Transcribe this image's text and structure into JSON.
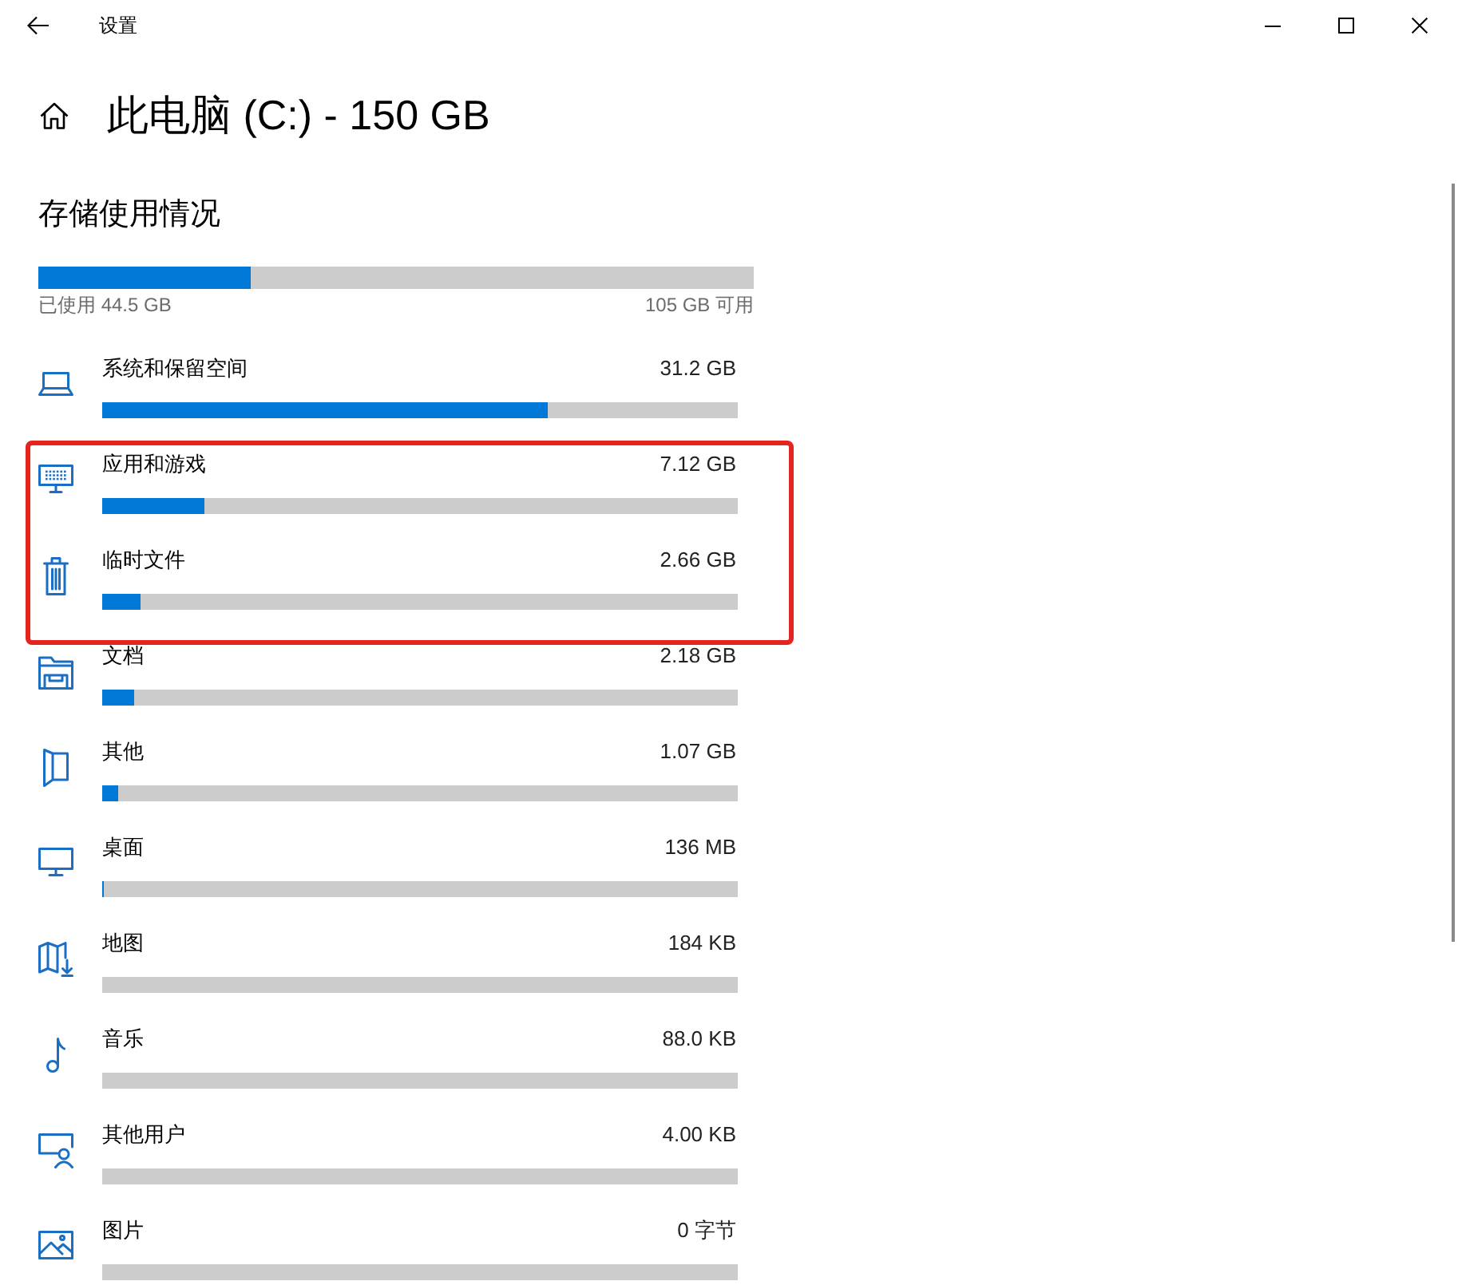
{
  "window": {
    "title": "设置"
  },
  "page": {
    "title": "此电脑 (C:) - 150 GB"
  },
  "storage": {
    "heading": "存储使用情况",
    "level": 0.297,
    "used": "已使用 44.5 GB",
    "free": "105 GB 可用"
  },
  "categories": [
    {
      "kind": "system",
      "label": "系统和保留空间",
      "size": "31.2 GB",
      "level": 0.701,
      "highlighted": false
    },
    {
      "kind": "apps",
      "label": "应用和游戏",
      "size": "7.12 GB",
      "level": 0.16,
      "highlighted": true
    },
    {
      "kind": "temp",
      "label": "临时文件",
      "size": "2.66 GB",
      "level": 0.06,
      "highlighted": true
    },
    {
      "kind": "documents",
      "label": "文档",
      "size": "2.18 GB",
      "level": 0.049,
      "highlighted": false
    },
    {
      "kind": "other",
      "label": "其他",
      "size": "1.07 GB",
      "level": 0.024,
      "highlighted": false
    },
    {
      "kind": "desktop",
      "label": "桌面",
      "size": "136 MB",
      "level": 0.003,
      "highlighted": false
    },
    {
      "kind": "maps",
      "label": "地图",
      "size": "184 KB",
      "highlighted": false
    },
    {
      "kind": "music",
      "label": "音乐",
      "size": "88.0 KB",
      "highlighted": false
    },
    {
      "kind": "users",
      "label": "其他用户",
      "size": "4.00 KB",
      "highlighted": false
    },
    {
      "kind": "pictures",
      "label": "图片",
      "size": "0 字节",
      "highlighted": false
    }
  ]
}
